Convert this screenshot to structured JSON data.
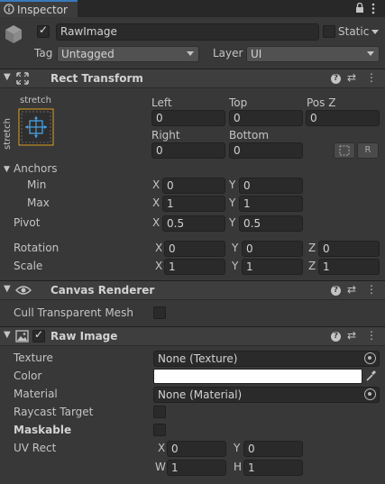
{
  "window": {
    "tab_label": "Inspector",
    "lock_icon": "lock-icon",
    "menu_icon": "kebab-menu-icon"
  },
  "gameobject": {
    "active": true,
    "name": "RawImage",
    "static_label": "Static",
    "static": false,
    "tag_label": "Tag",
    "tag_value": "Untagged",
    "layer_label": "Layer",
    "layer_value": "UI"
  },
  "rect_transform": {
    "title": "Rect Transform",
    "anchor_preset_label_top": "stretch",
    "anchor_preset_label_side": "stretch",
    "headers": {
      "left": "Left",
      "top": "Top",
      "posz": "Pos Z",
      "right": "Right",
      "bottom": "Bottom"
    },
    "values": {
      "left": "0",
      "top": "0",
      "posz": "0",
      "right": "0",
      "bottom": "0"
    },
    "raw_button": "R",
    "anchors_label": "Anchors",
    "min_label": "Min",
    "max_label": "Max",
    "min": {
      "x": "0",
      "y": "0"
    },
    "max": {
      "x": "1",
      "y": "1"
    },
    "pivot_label": "Pivot",
    "pivot": {
      "x": "0.5",
      "y": "0.5"
    },
    "rotation_label": "Rotation",
    "rotation": {
      "x": "0",
      "y": "0",
      "z": "0"
    },
    "scale_label": "Scale",
    "scale": {
      "x": "1",
      "y": "1",
      "z": "1"
    },
    "axes": {
      "x": "X",
      "y": "Y",
      "z": "Z",
      "w": "W",
      "h": "H"
    }
  },
  "canvas_renderer": {
    "title": "Canvas Renderer",
    "cull_label": "Cull Transparent Mesh",
    "cull": false
  },
  "raw_image": {
    "title": "Raw Image",
    "enabled": true,
    "texture_label": "Texture",
    "texture_value": "None (Texture)",
    "color_label": "Color",
    "color_value": "#ffffff",
    "material_label": "Material",
    "material_value": "None (Material)",
    "raycast_label": "Raycast Target",
    "raycast": false,
    "maskable_label": "Maskable",
    "maskable": false,
    "uvrect_label": "UV Rect",
    "uvrect": {
      "x": "0",
      "y": "0",
      "w": "1",
      "h": "1"
    }
  },
  "colors": {
    "background": "#383838",
    "header": "#3e3e3e",
    "field": "#2a2a2a",
    "accent": "#3a79bb",
    "anchor_frame": "#e0a020"
  }
}
